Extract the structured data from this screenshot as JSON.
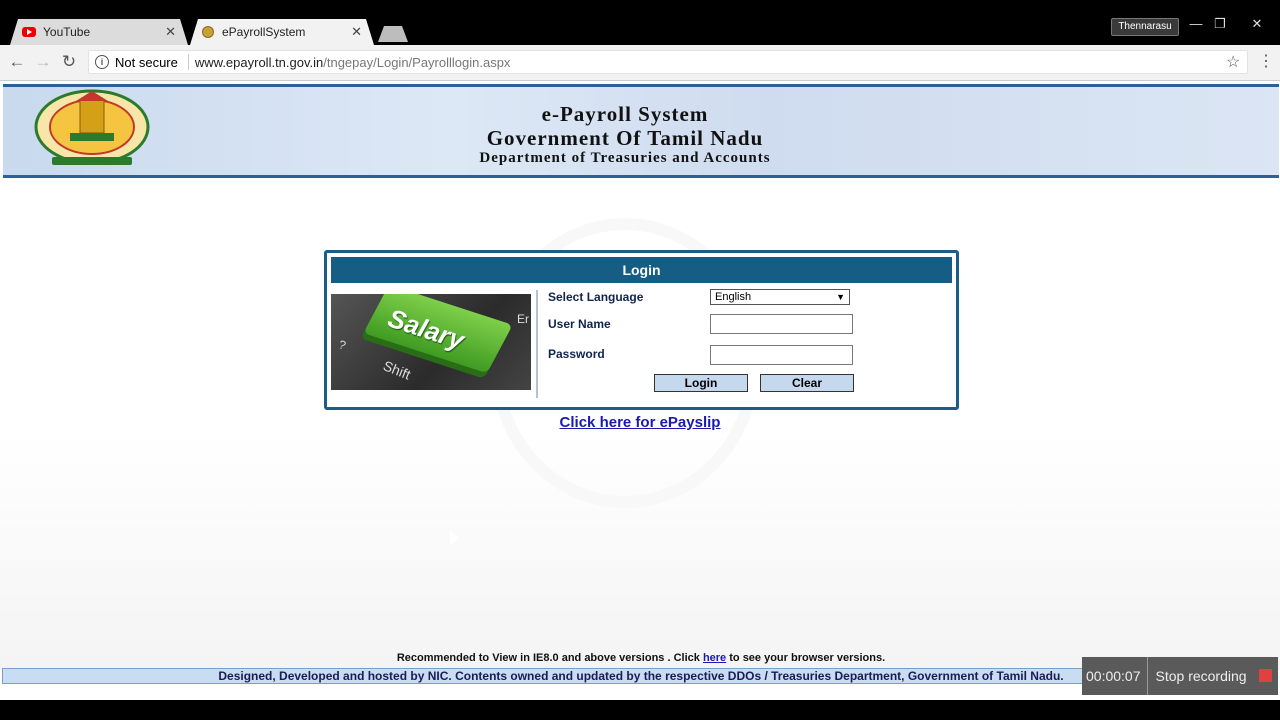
{
  "browser": {
    "tabs": [
      {
        "label": "YouTube",
        "icon": "youtube-icon",
        "active": false
      },
      {
        "label": "ePayrollSystem",
        "icon": "emblem-favicon",
        "active": true
      }
    ],
    "profile_name": "Thennarasu",
    "security_label": "Not secure",
    "url_host": "www.epayroll.tn.gov.in",
    "url_path": "/tngepay/Login/Payrolllogin.aspx"
  },
  "banner": {
    "title": "e-Payroll System",
    "government": "Government Of Tamil Nadu",
    "department": "Department of Treasuries and Accounts"
  },
  "login": {
    "header": "Login",
    "image_text": {
      "key": "Salary",
      "shift": "Shift",
      "q": "?",
      "e": "Er"
    },
    "language_label": "Select Language",
    "language_value": "English",
    "username_label": "User Name",
    "username_value": "",
    "password_label": "Password",
    "password_value": "",
    "login_button": "Login",
    "clear_button": "Clear"
  },
  "payslip_link": "Click here for ePayslip",
  "footer": {
    "note_prefix": "Recommended to View in IE8.0 and above versions . Click",
    "note_link": "here",
    "note_suffix": "to see your browser versions.",
    "credit": "Designed, Developed and hosted by NIC. Contents owned and updated by the respective DDOs / Treasuries Department, Government of Tamil Nadu."
  },
  "recorder": {
    "time": "00:00:07",
    "stop_label": "Stop recording"
  },
  "colors": {
    "header_blue": "#165d86",
    "banner_border": "#2f5f9b",
    "link_blue": "#1a1ab0"
  }
}
